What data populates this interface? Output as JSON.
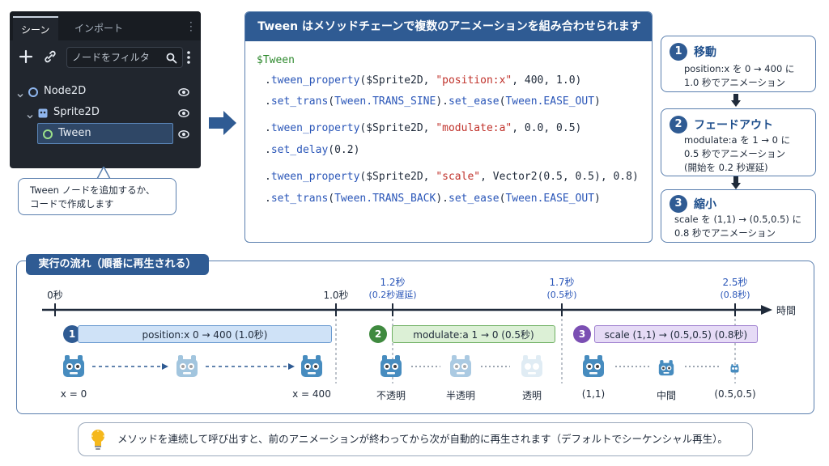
{
  "scene_panel": {
    "tabs": [
      "シーン",
      "インポート"
    ],
    "filter_placeholder": "ノードをフィルタ",
    "nodes": [
      "Node2D",
      "Sprite2D",
      "Tween"
    ]
  },
  "note_add": {
    "lines": [
      "Tween ノードを追加するか、",
      "コードで作成します"
    ]
  },
  "code_panel": {
    "title": "Tween はメソッドチェーンで複数のアニメーションを組み合わせられます",
    "var": "$Tween",
    "lines": [
      [
        ".",
        "tween_property",
        "($Sprite2D, ",
        "\"position:x\"",
        ", 400, 1.0)"
      ],
      [
        ".",
        "set_trans",
        "(",
        "Tween.TRANS_SINE",
        ").",
        "set_ease",
        "(",
        "Tween.EASE_OUT",
        ")"
      ],
      [
        ".",
        "tween_property",
        "($Sprite2D, ",
        "\"modulate:a\"",
        ", 0.0, 0.5)"
      ],
      [
        ".",
        "set_delay",
        "(0.2)"
      ],
      [
        ".",
        "tween_property",
        "($Sprite2D, ",
        "\"scale\"",
        ", Vector2(0.5, 0.5), 0.8)"
      ],
      [
        ".",
        "set_trans",
        "(",
        "Tween.TRANS_BACK",
        ").",
        "set_ease",
        "(",
        "Tween.EASE_OUT",
        ")"
      ]
    ]
  },
  "steps": [
    {
      "num": "1",
      "title": "移動",
      "desc": [
        "position:x を 0 → 400 に",
        "1.0 秒でアニメーション"
      ]
    },
    {
      "num": "2",
      "title": "フェードアウト",
      "desc": [
        "modulate:a を 1 → 0 に",
        "0.5 秒でアニメーション",
        "(開始を 0.2 秒遅延)"
      ]
    },
    {
      "num": "3",
      "title": "縮小",
      "desc": [
        "scale を (1,1) → (0.5,0.5) に",
        "0.8 秒でアニメーション"
      ]
    }
  ],
  "timeline": {
    "header": "実行の流れ（順番に再生される）",
    "axis_label": "時間",
    "ticks": [
      {
        "label": "0秒",
        "sub": ""
      },
      {
        "label": "1.0秒",
        "sub": ""
      },
      {
        "label": "1.2秒",
        "sub": "(0.2秒遅延)"
      },
      {
        "label": "1.7秒",
        "sub": "(0.5秒)"
      },
      {
        "label": "2.5秒",
        "sub": "(0.8秒)"
      }
    ],
    "bars": [
      {
        "num": "1",
        "label": "position:x  0 → 400 (1.0秒)"
      },
      {
        "num": "2",
        "label": "modulate:a 1 → 0 (0.5秒)"
      },
      {
        "num": "3",
        "label": "scale (1,1) → (0.5,0.5) (0.8秒)"
      }
    ],
    "captions": [
      "x = 0",
      "x = 400",
      "不透明",
      "半透明",
      "透明",
      "(1,1)",
      "中間",
      "(0.5,0.5)"
    ]
  },
  "tip": "メソッドを連続して呼び出すと、前のアニメーションが終わってから次が自動的に再生されます（デフォルトでシーケンシャル再生）。",
  "colors": {
    "primary": "#2f5b93",
    "step2": "#3f8a3f",
    "step3": "#7b4fb3",
    "godot_blue": "#478cbf"
  }
}
